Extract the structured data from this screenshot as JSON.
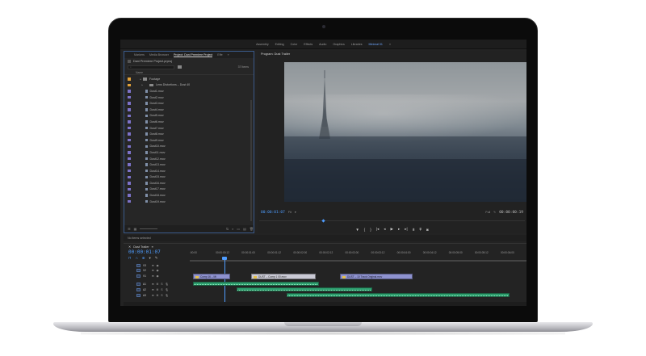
{
  "workspaces": [
    "Assembly",
    "Editing",
    "Color",
    "Effects",
    "Audio",
    "Graphics",
    "Libraries",
    "Minimal 01",
    "»"
  ],
  "workspace_active_index": 7,
  "project_panel": {
    "tabs": [
      "Markers",
      "Media Browser",
      "Project: Dani Premiere Project",
      "Effe",
      "»"
    ],
    "active_tab_index": 2,
    "project_name": "Dani Premiere Project.prproj",
    "search_placeholder": "",
    "item_count": "37 Items",
    "column_header": "Name",
    "items": [
      {
        "name": "Footage",
        "type": "folder",
        "color": "orange"
      },
      {
        "name": "Lens Distortions – Dust 40",
        "type": "folder",
        "color": "orange"
      },
      {
        "name": "Dust1.mov",
        "type": "clip"
      },
      {
        "name": "Dust2.mov",
        "type": "clip"
      },
      {
        "name": "Dust3.mov",
        "type": "clip"
      },
      {
        "name": "Dust4.mov",
        "type": "clip"
      },
      {
        "name": "Dust5.mov",
        "type": "clip"
      },
      {
        "name": "Dust6.mov",
        "type": "clip"
      },
      {
        "name": "Dust7.mov",
        "type": "clip"
      },
      {
        "name": "Dust8.mov",
        "type": "clip"
      },
      {
        "name": "Dust9.mov",
        "type": "clip"
      },
      {
        "name": "Dust10.mov",
        "type": "clip"
      },
      {
        "name": "Dust11.mov",
        "type": "clip"
      },
      {
        "name": "Dust12.mov",
        "type": "clip"
      },
      {
        "name": "Dust13.mov",
        "type": "clip"
      },
      {
        "name": "Dust14.mov",
        "type": "clip"
      },
      {
        "name": "Dust15.mov",
        "type": "clip"
      },
      {
        "name": "Dust16.mov",
        "type": "clip"
      },
      {
        "name": "Dust17.mov",
        "type": "clip"
      },
      {
        "name": "Dust18.mov",
        "type": "clip"
      },
      {
        "name": "Dust19.mov",
        "type": "clip"
      }
    ]
  },
  "program_monitor": {
    "title": "Program: Dust Trailer",
    "timecode_current": "00:00:01:07",
    "fit_label": "Fit",
    "quality_label": "Full",
    "timecode_total": "00:00:00:19"
  },
  "transport_icons": [
    "marker-icon",
    "in-point-icon",
    "out-point-icon",
    "go-to-in-icon",
    "step-back-icon",
    "play-icon",
    "step-forward-icon",
    "go-to-out-icon",
    "lift-icon",
    "extract-icon",
    "camera-icon"
  ],
  "info_bar": {
    "text": "No items selected"
  },
  "timeline": {
    "title": "Dust Trailer",
    "timecode": "00:00:01:07",
    "ruler_labels": [
      ":00:00",
      "00:00:00:12",
      "00:00:01:00",
      "00:00:01:12",
      "00:00:02:00",
      "00:00:02:12",
      "00:00:03:00",
      "00:00:03:12",
      "00:00:04:00",
      "00:00:04:12",
      "00:00:05:00",
      "00:00:05:12",
      "00:00:06:00"
    ],
    "tracks": [
      "V3",
      "V2",
      "V1",
      "A1",
      "A2",
      "A3"
    ],
    "clips": {
      "v1_a": "Comp 16 – Mi",
      "v1_b": "DUST – Comp 1 00.mov",
      "v1_c": "DUST – 10 Track Original.mov"
    }
  },
  "colors": {
    "accent_blue": "#4f9dff",
    "video_clip": "#8e92cf",
    "audio_clip": "#2f9e6f",
    "folder_label": "#e0a13a",
    "clip_label": "#7d72c9"
  }
}
